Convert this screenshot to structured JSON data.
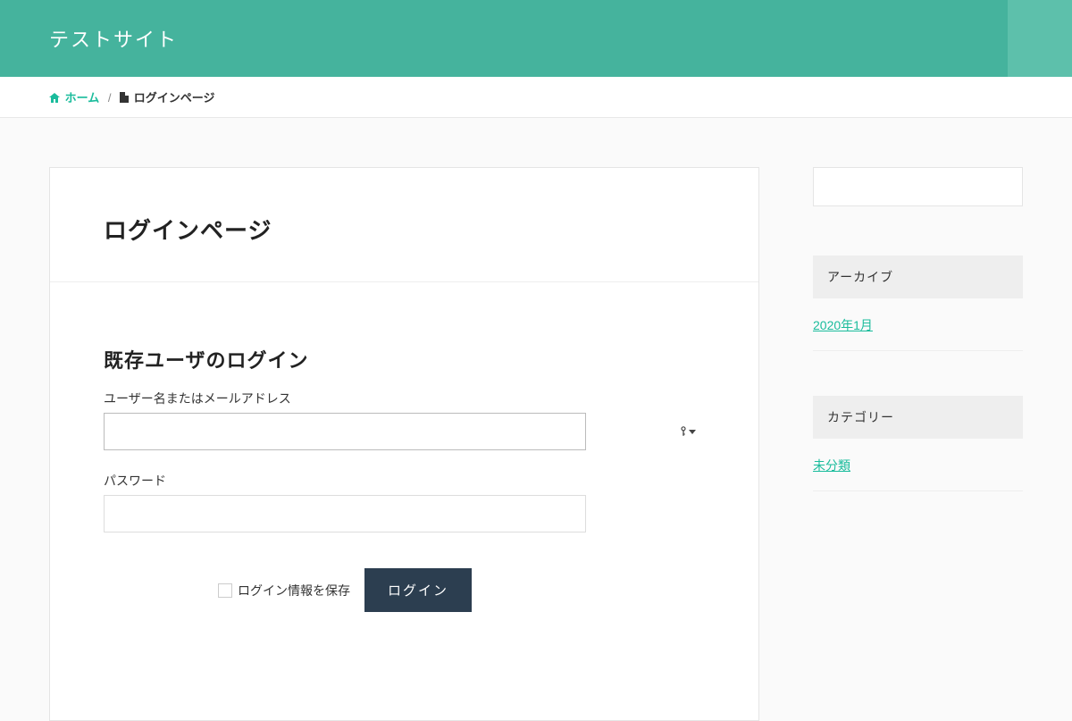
{
  "header": {
    "site_title": "テストサイト"
  },
  "breadcrumb": {
    "home_label": "ホーム",
    "separator": "/",
    "current_label": "ログインページ"
  },
  "page": {
    "title": "ログインページ"
  },
  "login_form": {
    "heading": "既存ユーザのログイン",
    "username_label": "ユーザー名またはメールアドレス",
    "username_value": "",
    "password_label": "パスワード",
    "password_value": "",
    "remember_label": "ログイン情報を保存",
    "submit_label": "ログイン"
  },
  "sidebar": {
    "search_placeholder": "",
    "archive": {
      "title": "アーカイブ",
      "links": [
        "2020年1月"
      ]
    },
    "category": {
      "title": "カテゴリー",
      "links": [
        "未分類"
      ]
    }
  },
  "colors": {
    "accent": "#45b39d",
    "link": "#1abc9c",
    "button": "#2c3e50"
  }
}
